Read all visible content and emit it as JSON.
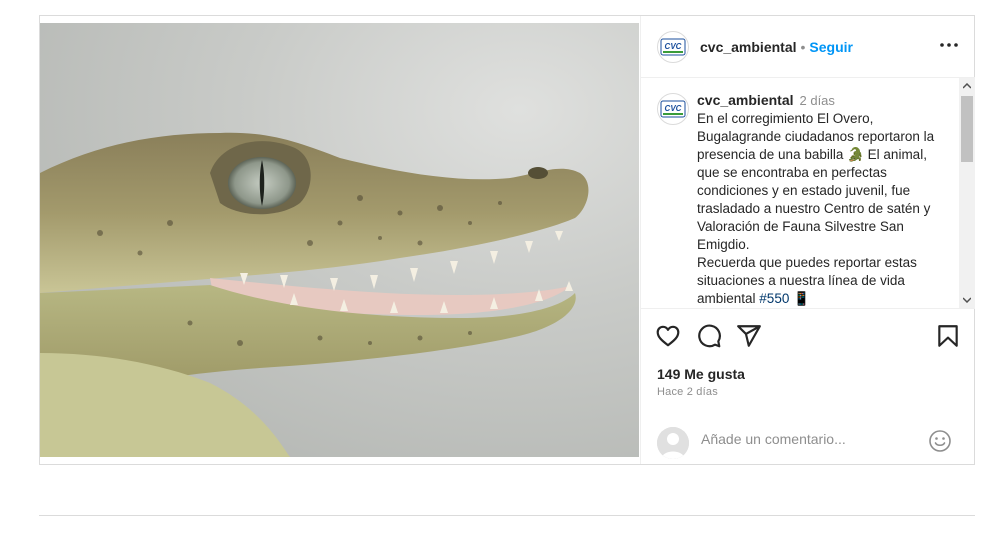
{
  "post": {
    "username": "cvc_ambiental",
    "follow_label": "Seguir",
    "bullet": "•",
    "avatar_text": "CVC",
    "media": {
      "image_icon": "caiman-photo",
      "slide_count": 3,
      "active_slide": 0
    },
    "caption": {
      "username": "cvc_ambiental",
      "time_ago": "2 días",
      "part1": "En el corregimiento El Overo, Bugalagrande ciudadanos reportaron la presencia de una babilla 🐊 El animal, que se encontraba en perfectas condiciones y en estado juvenil, fue trasladado a nuestro Centro de satén y Valoración de Fauna Silvestre San Emigdio.",
      "part2": "Recuerda que puedes reportar estas situaciones a nuestra línea de vida ambiental ",
      "hashtag": "#550",
      "emoji_end": "📱"
    },
    "likes_text": "149 Me gusta",
    "posted_text": "Hace 2 días",
    "comment_placeholder": "Añade un comentario...",
    "icons": {
      "like": "heart-icon",
      "comment": "comment-icon",
      "share": "share-icon",
      "save": "bookmark-icon",
      "more": "more-options-icon",
      "emoji": "emoji-icon",
      "next": "chevron-right-icon"
    },
    "colors": {
      "accent": "#0095f6",
      "text": "#262626",
      "muted": "#8e8e8e",
      "border": "#dbdbdb"
    }
  }
}
